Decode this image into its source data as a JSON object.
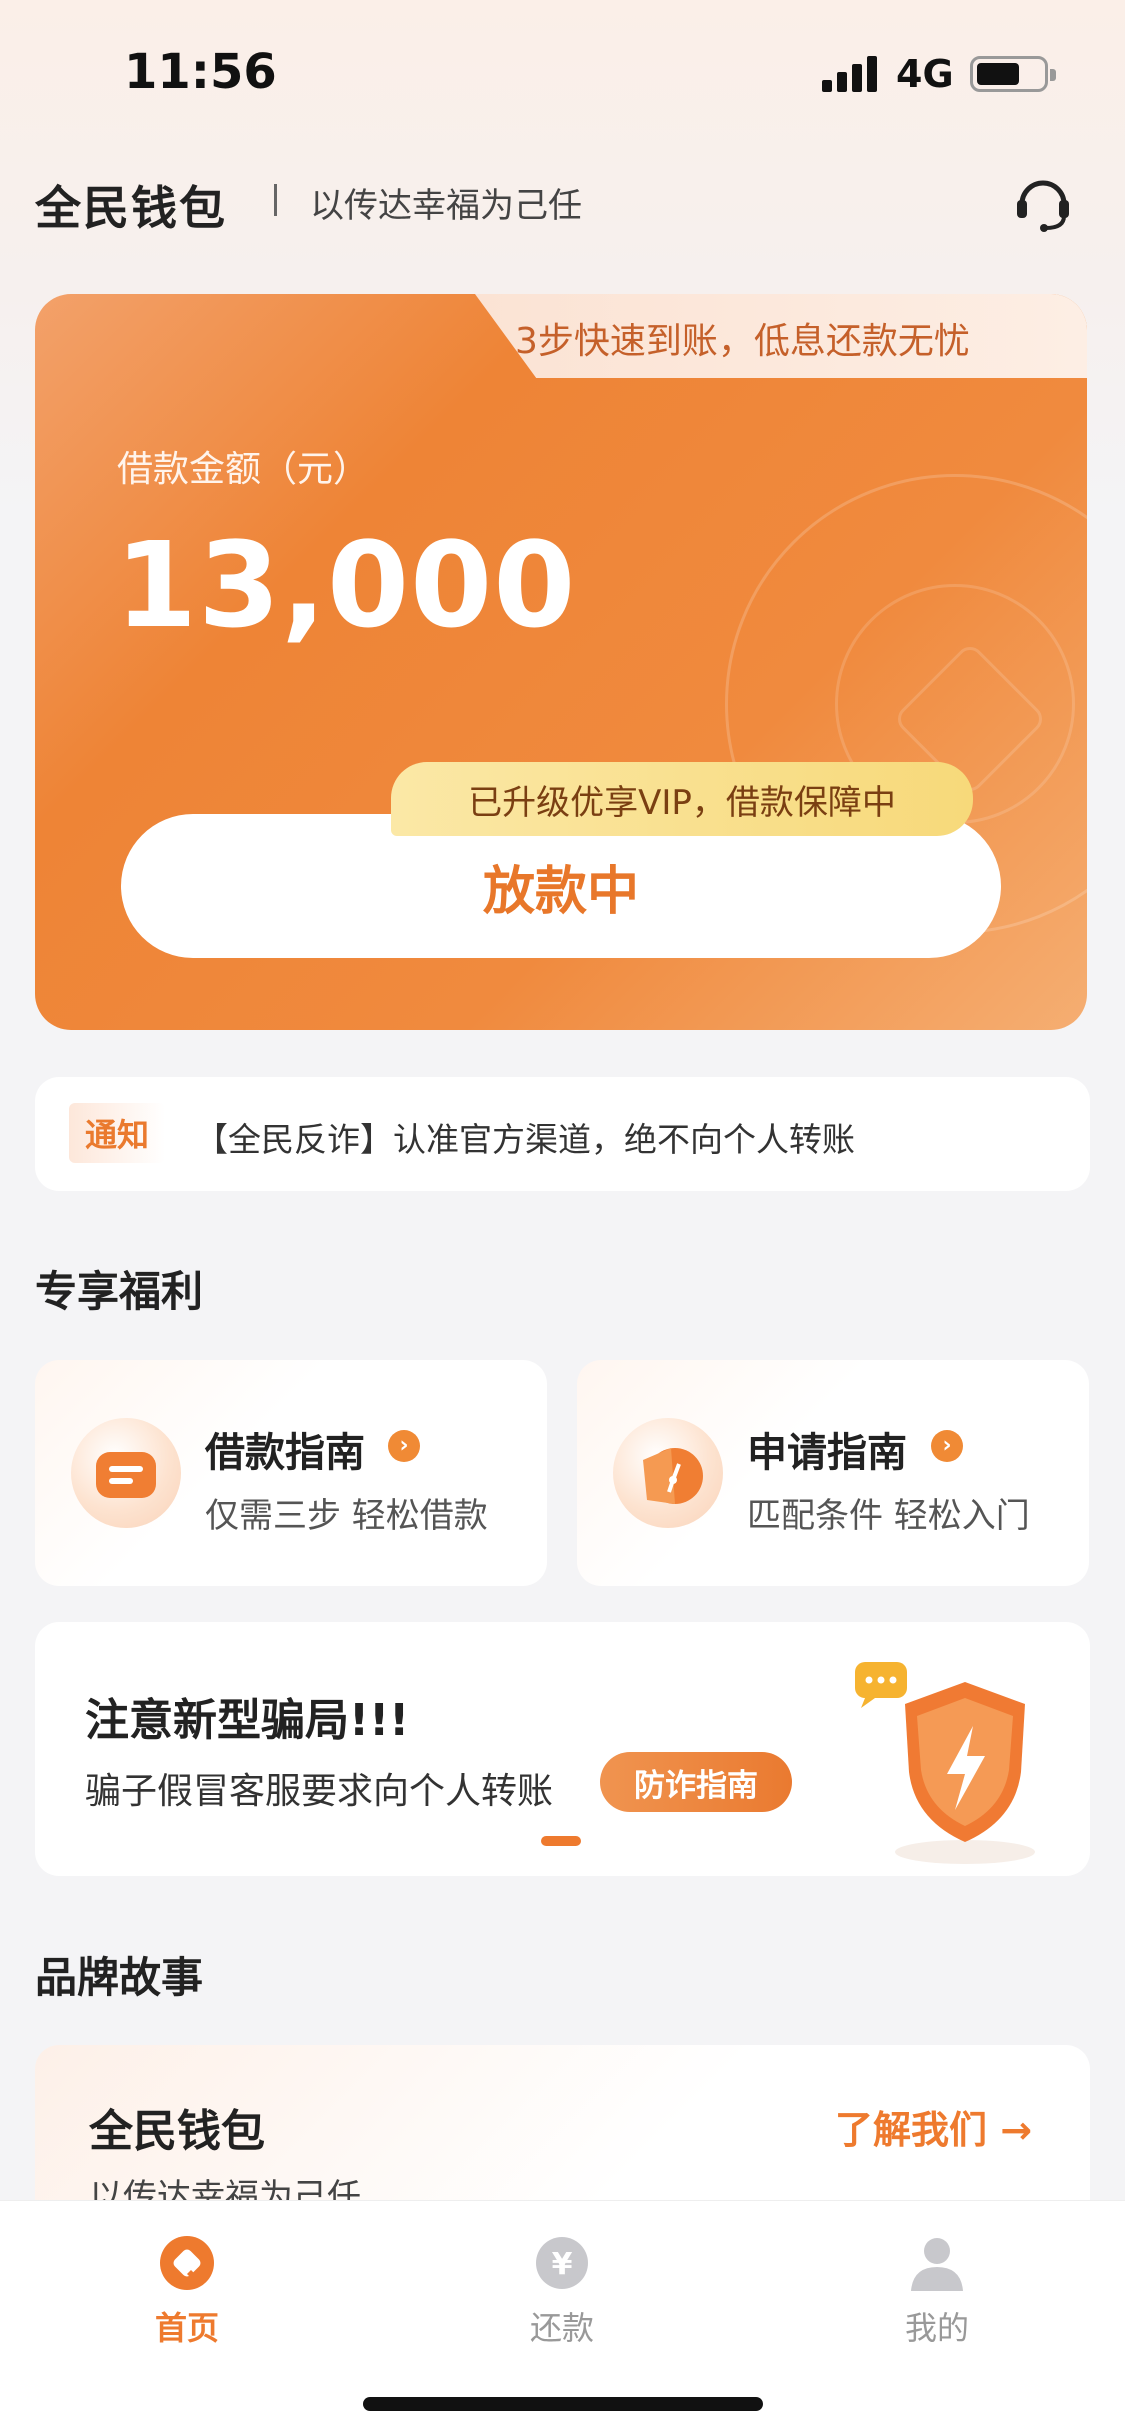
{
  "status_bar": {
    "time": "11:56",
    "network": "4G"
  },
  "header": {
    "title": "全民钱包",
    "slogan": "以传达幸福为己任"
  },
  "loan_card": {
    "tab_text": "3步快速到账，低息还款无忧",
    "amount_label": "借款金额（元）",
    "amount": "13,000",
    "vip_text": "已升级优享VIP，借款保障中",
    "status": "放款中"
  },
  "notice": {
    "tag": "通知",
    "text": "【全民反诈】认准官方渠道，绝不向个人转账"
  },
  "benefits": {
    "section_title": "专享福利",
    "items": [
      {
        "title": "借款指南",
        "subtitle": "仅需三步 轻松借款"
      },
      {
        "title": "申请指南",
        "subtitle": "匹配条件 轻松入门"
      }
    ]
  },
  "fraud": {
    "title": "注意新型骗局!!!",
    "subtitle": "骗子假冒客服要求向个人转账",
    "button": "防诈指南"
  },
  "brand": {
    "section_title": "品牌故事",
    "title": "全民钱包",
    "link": "了解我们 →",
    "subtitle": "以传达幸福为己任"
  },
  "tabbar": {
    "items": [
      {
        "label": "首页",
        "active": true
      },
      {
        "label": "还款",
        "active": false
      },
      {
        "label": "我的",
        "active": false
      }
    ],
    "active_color": "#ee7a2e",
    "inactive_color": "#999999"
  }
}
